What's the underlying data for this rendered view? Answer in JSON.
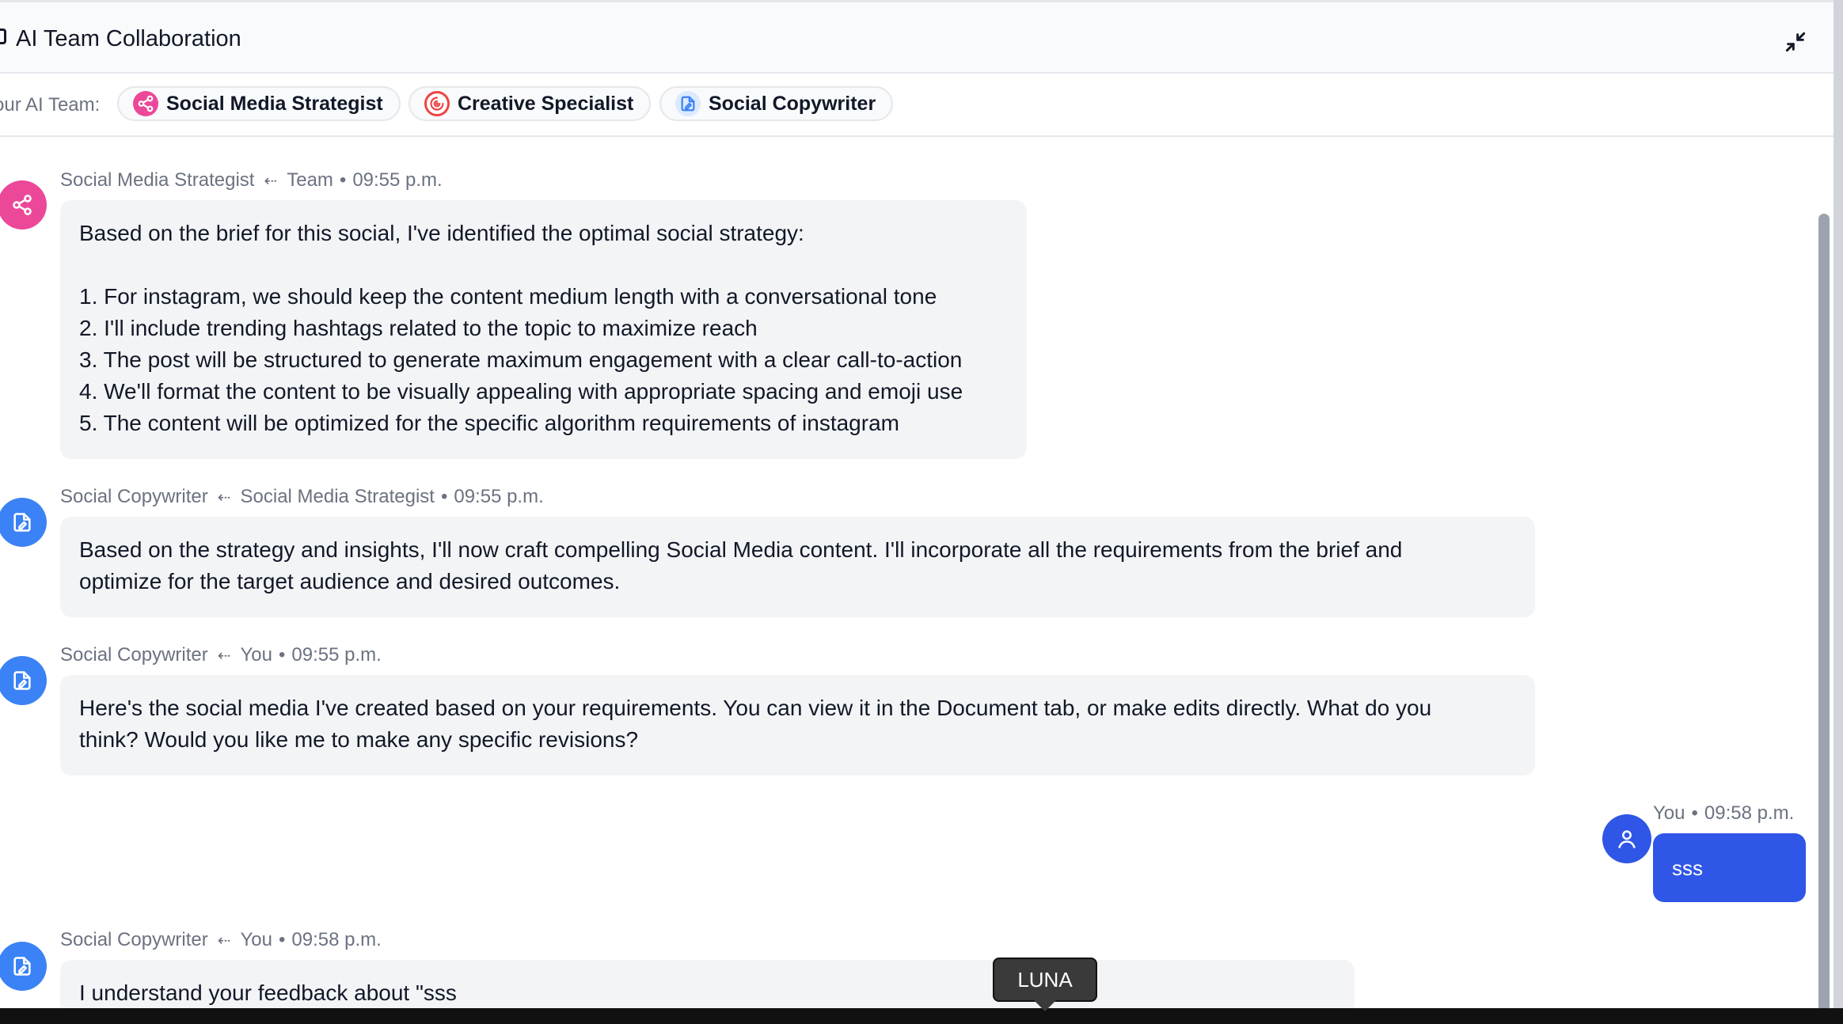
{
  "header": {
    "title": "AI Team Collaboration"
  },
  "team": {
    "label": "our AI Team:",
    "members": [
      {
        "name": "Social Media Strategist",
        "icon": "share-network-icon",
        "color": "#ec4899"
      },
      {
        "name": "Creative Specialist",
        "icon": "creative-swirl-icon",
        "color": "#ef4444"
      },
      {
        "name": "Social Copywriter",
        "icon": "document-pen-icon",
        "color": "#3b82f6"
      }
    ]
  },
  "messages": [
    {
      "from": "Social Media Strategist",
      "to": "Team",
      "time": "09:55 p.m.",
      "avatar_icon": "share-network-icon",
      "lines": [
        "Based on the brief for this social, I've identified the optimal social strategy:",
        "",
        "1. For instagram, we should keep the content medium length with a conversational tone",
        "2. I'll include trending hashtags related to the topic to maximize reach",
        "3. The post will be structured to generate maximum engagement with a clear call-to-action",
        "4. We'll format the content to be visually appealing with appropriate spacing and emoji use",
        "5. The content will be optimized for the specific algorithm requirements of instagram"
      ]
    },
    {
      "from": "Social Copywriter",
      "to": "Social Media Strategist",
      "time": "09:55 p.m.",
      "avatar_icon": "document-pen-icon",
      "lines": [
        "Based on the strategy and insights, I'll now craft compelling Social Media content. I'll incorporate all the requirements from the brief and",
        "optimize for the target audience and desired outcomes."
      ]
    },
    {
      "from": "Social Copywriter",
      "to": "You",
      "time": "09:55 p.m.",
      "avatar_icon": "document-pen-icon",
      "lines": [
        "Here's the social media I've created based on your requirements. You can view it in the Document tab, or make edits directly. What do you",
        "think? Would you like me to make any specific revisions?"
      ]
    },
    {
      "from": "You",
      "time": "09:58 p.m.",
      "avatar_icon": "user-icon",
      "text": "sss"
    },
    {
      "from": "Social Copywriter",
      "to": "You",
      "time": "09:58 p.m.",
      "avatar_icon": "document-pen-icon",
      "lines": [
        "I understand your feedback about \"sss"
      ]
    }
  ],
  "tooltip": {
    "text": "LUNA"
  },
  "colors": {
    "accent": "#2f56e6",
    "strategist": "#ec4899",
    "copywriter": "#3b82f6",
    "bubble": "#f3f4f6"
  }
}
